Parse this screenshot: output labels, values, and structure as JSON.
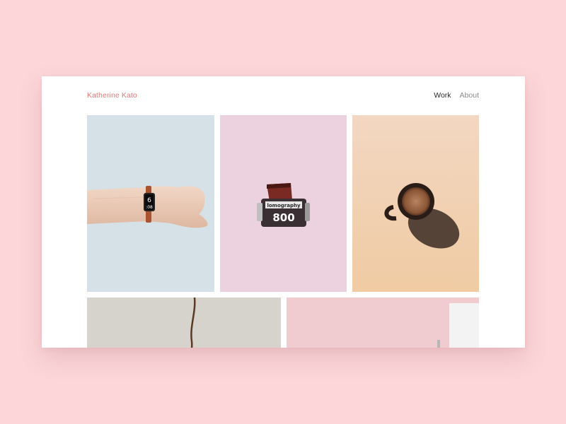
{
  "site": {
    "brand_name": "Katherine Kato",
    "nav": [
      {
        "label": "Work",
        "active": true
      },
      {
        "label": "About",
        "active": false
      }
    ]
  },
  "gallery": [
    {
      "subject": "wrist-with-watch",
      "background": "#d5e1e6"
    },
    {
      "subject": "film-canister",
      "background": "#ecd2de",
      "printed_text": [
        "lomography",
        "800"
      ]
    },
    {
      "subject": "coffee-cup",
      "background": "#f0d3b4"
    },
    {
      "subject": "hanging-cable",
      "background": "#d6d2cc"
    },
    {
      "subject": "pink-wall-with-white-panel",
      "background": "#f0ccd0"
    }
  ],
  "watch": {
    "display": "6",
    "display_small": ":08"
  },
  "colors": {
    "page_background": "#fcd6d9",
    "brand_accent": "#e57878"
  }
}
